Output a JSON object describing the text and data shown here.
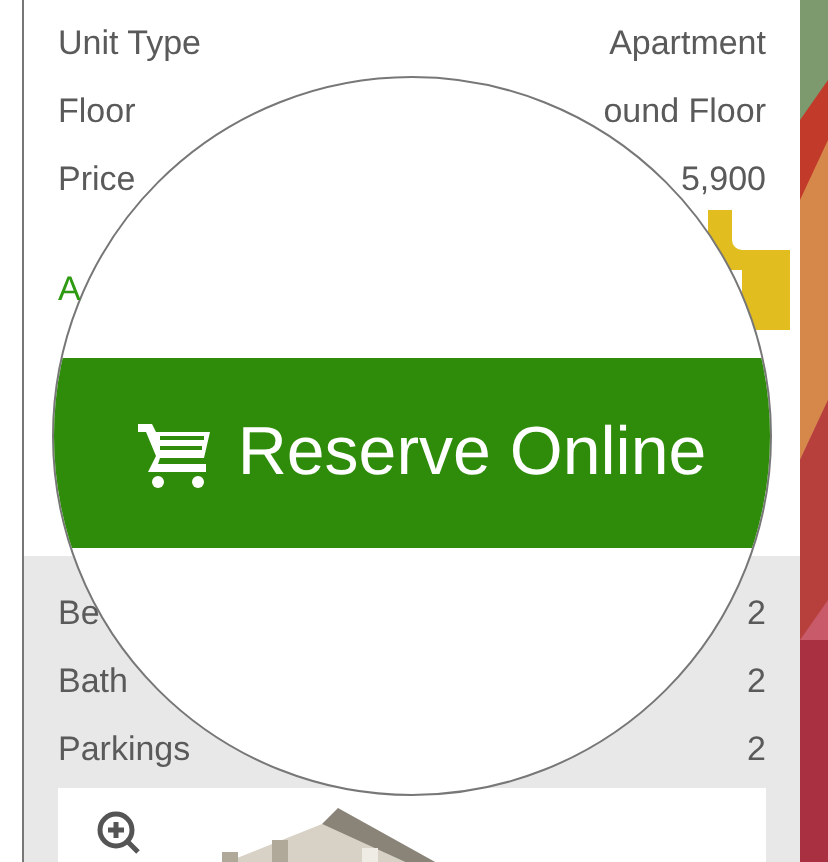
{
  "details": [
    {
      "label": "Unit Type",
      "value": "Apartment"
    },
    {
      "label": "Floor",
      "value": "ound Floor"
    },
    {
      "label": "Price",
      "value": "5,900"
    }
  ],
  "link": "A",
  "magnifier": {
    "button": {
      "label": "Reserve Online"
    }
  },
  "features": [
    {
      "label": "Be",
      "value": "2"
    },
    {
      "label": "Bath",
      "value": "2"
    },
    {
      "label": "Parkings",
      "value": "2"
    }
  ]
}
